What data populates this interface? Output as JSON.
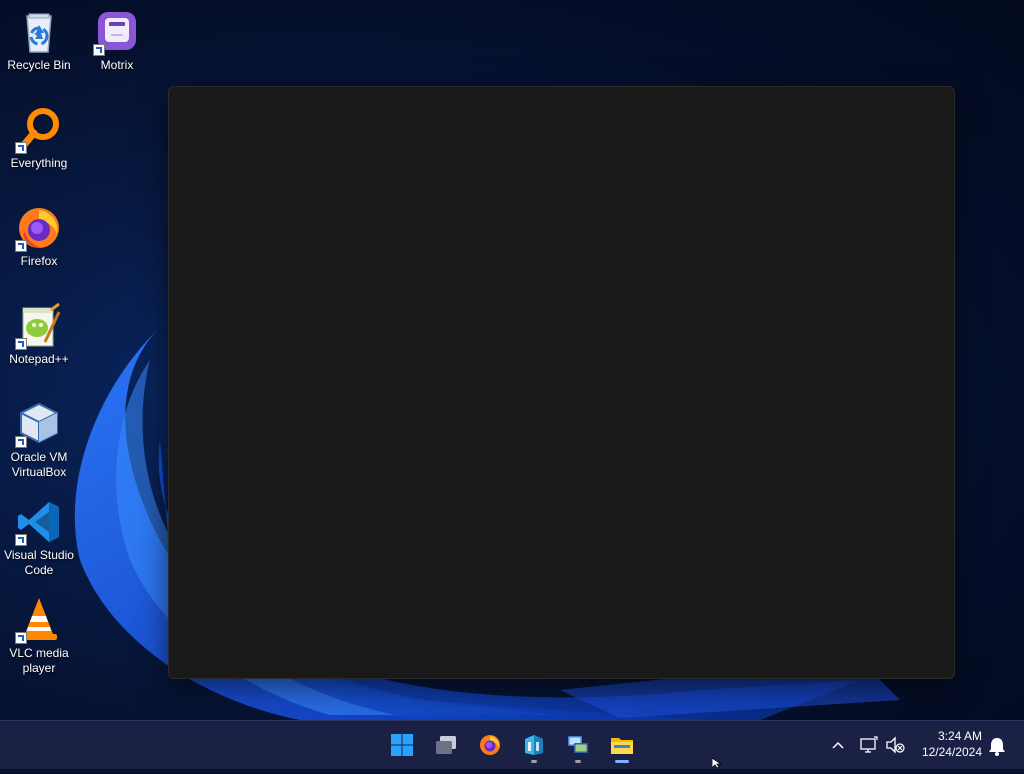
{
  "desktop": {
    "icons": [
      {
        "label": "Recycle Bin",
        "icon": "recycle-bin-icon"
      },
      {
        "label": "Motrix",
        "icon": "motrix-icon"
      },
      {
        "label": "Everything",
        "icon": "everything-icon"
      },
      {
        "label": "Firefox",
        "icon": "firefox-icon"
      },
      {
        "label": "Notepad++",
        "icon": "notepadpp-icon"
      },
      {
        "label": "Oracle VM VirtualBox",
        "icon": "virtualbox-icon"
      },
      {
        "label": "Visual Studio Code",
        "icon": "vscode-icon"
      },
      {
        "label": "VLC media player",
        "icon": "vlc-icon"
      }
    ]
  },
  "taskbar": {
    "apps": [
      {
        "name": "Start",
        "icon": "windows-start-icon"
      },
      {
        "name": "Task View",
        "icon": "task-view-icon"
      },
      {
        "name": "Firefox",
        "icon": "firefox-icon"
      },
      {
        "name": "Azure Storage Explorer",
        "icon": "storage-explorer-icon"
      },
      {
        "name": "Network App",
        "icon": "network-app-icon"
      },
      {
        "name": "File Explorer",
        "icon": "file-explorer-icon"
      }
    ],
    "clock": {
      "time": "3:24 AM",
      "date": "12/24/2024"
    }
  },
  "colors": {
    "window_bg": "#191919",
    "taskbar_bg": "#1b2144",
    "accent": "#0078d4"
  }
}
